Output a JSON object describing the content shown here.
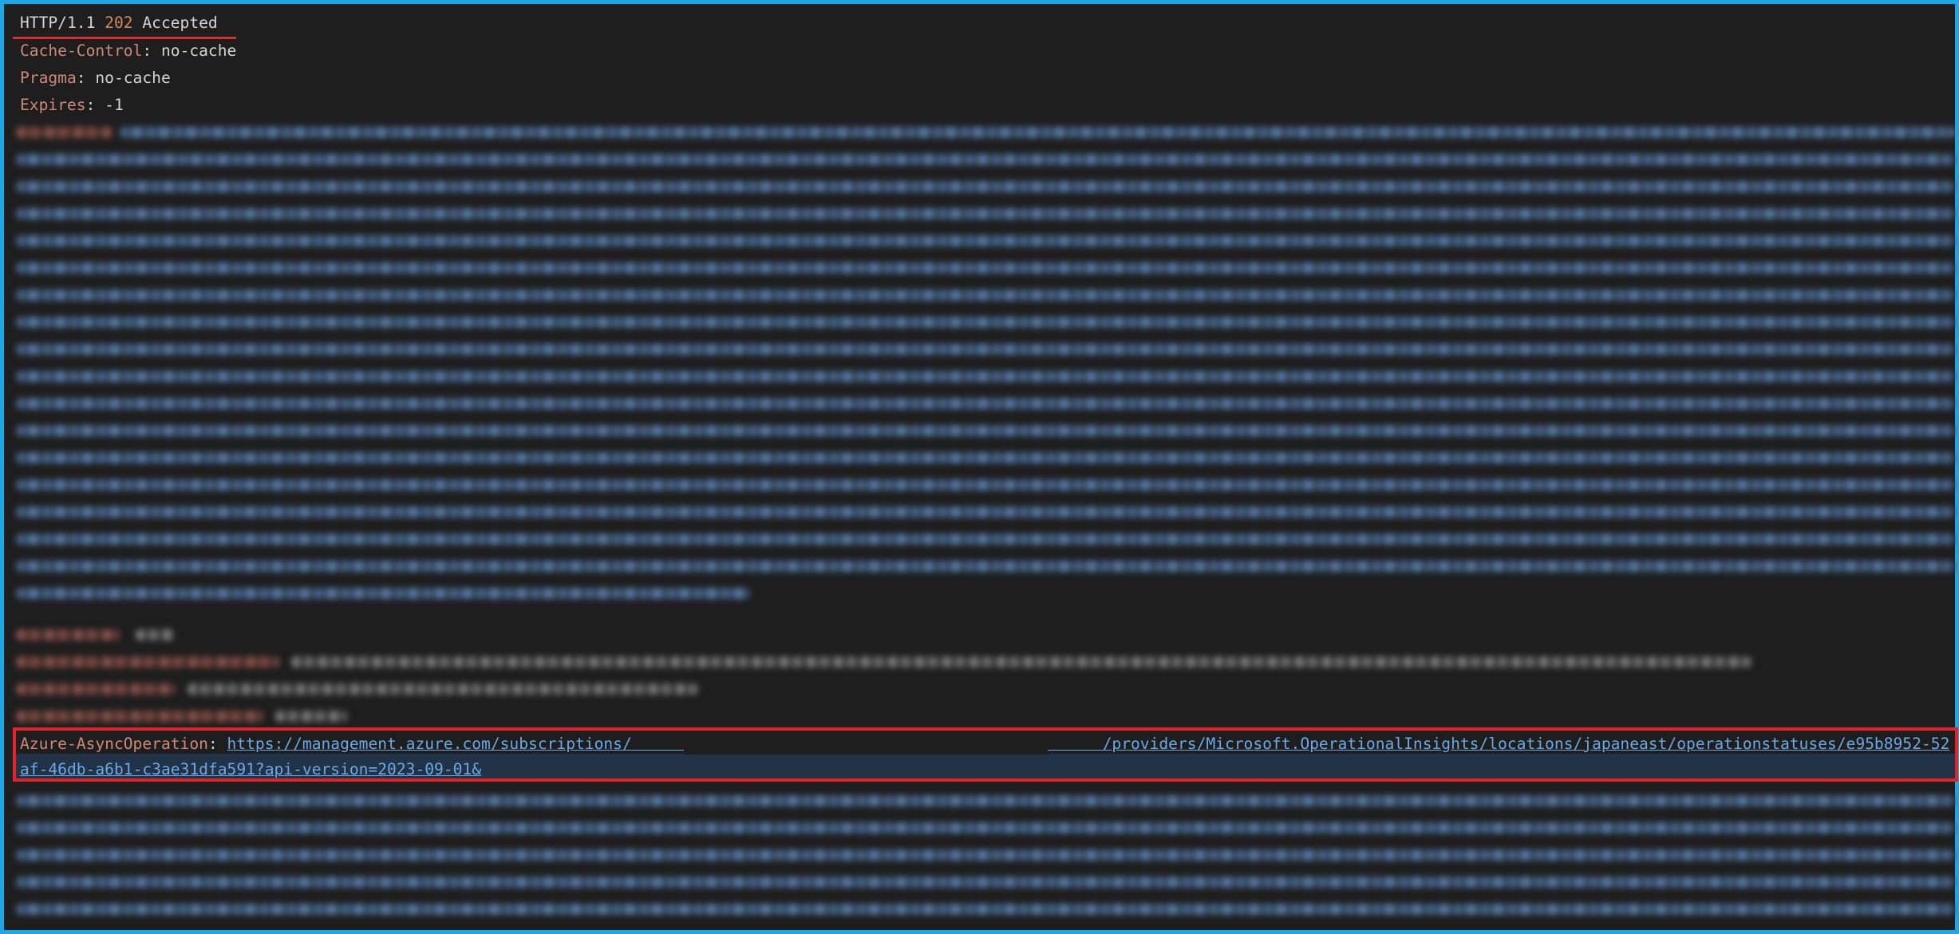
{
  "status": {
    "protocol": "HTTP/1.1",
    "code": "202",
    "text": "Accepted"
  },
  "headers": [
    {
      "name": "Cache-Control",
      "value": "no-cache"
    },
    {
      "name": "Pragma",
      "value": "no-cache"
    },
    {
      "name": "Expires",
      "value": "-1"
    }
  ],
  "async_operation": {
    "name": "Azure-AsyncOperation",
    "url_part1": "https://management.azure.com/subscriptions/",
    "url_part2": "/providers/Microsoft.OperationalInsights/locations/japaneast/operationstatuses/e95b8952-52",
    "url_part3": "af-46db-a6b1-c3ae31dfa591?api-version=2023-09-01&"
  },
  "colors": {
    "border": "#1ea7e6",
    "background": "#1e1e1e",
    "header_name": "#d08878",
    "status_code": "#d18a5a",
    "link": "#6aa9e8",
    "highlight": "#e0262a"
  }
}
